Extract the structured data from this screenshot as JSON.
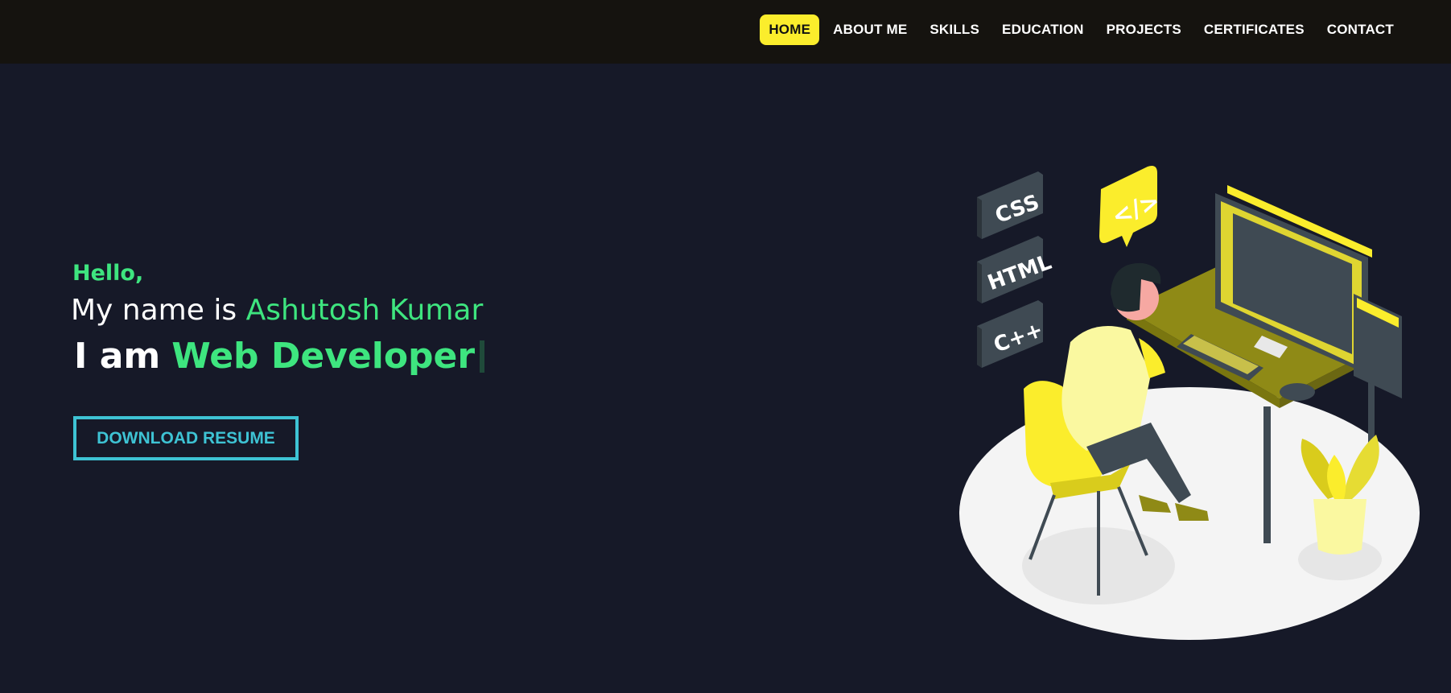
{
  "nav": {
    "items": [
      {
        "label": "HOME",
        "active": true
      },
      {
        "label": "ABOUT ME",
        "active": false
      },
      {
        "label": "SKILLS",
        "active": false
      },
      {
        "label": "EDUCATION",
        "active": false
      },
      {
        "label": "PROJECTS",
        "active": false
      },
      {
        "label": "CERTIFICATES",
        "active": false
      },
      {
        "label": "CONTACT",
        "active": false
      }
    ]
  },
  "hero": {
    "greeting": "Hello,",
    "name_prefix": "My name is",
    "name": "Ashutosh Kumar",
    "role_prefix": "I am",
    "role": "Web Developer",
    "resume_button": "DOWNLOAD RESUME"
  },
  "illustration": {
    "tiles": [
      "CSS",
      "HTML",
      "C++"
    ],
    "code_bubble": "</>"
  },
  "colors": {
    "background": "#161928",
    "navbar": "#15130f",
    "accent_yellow": "#fbed2c",
    "accent_green": "#3ee57f",
    "accent_cyan": "#3ec3d4"
  }
}
